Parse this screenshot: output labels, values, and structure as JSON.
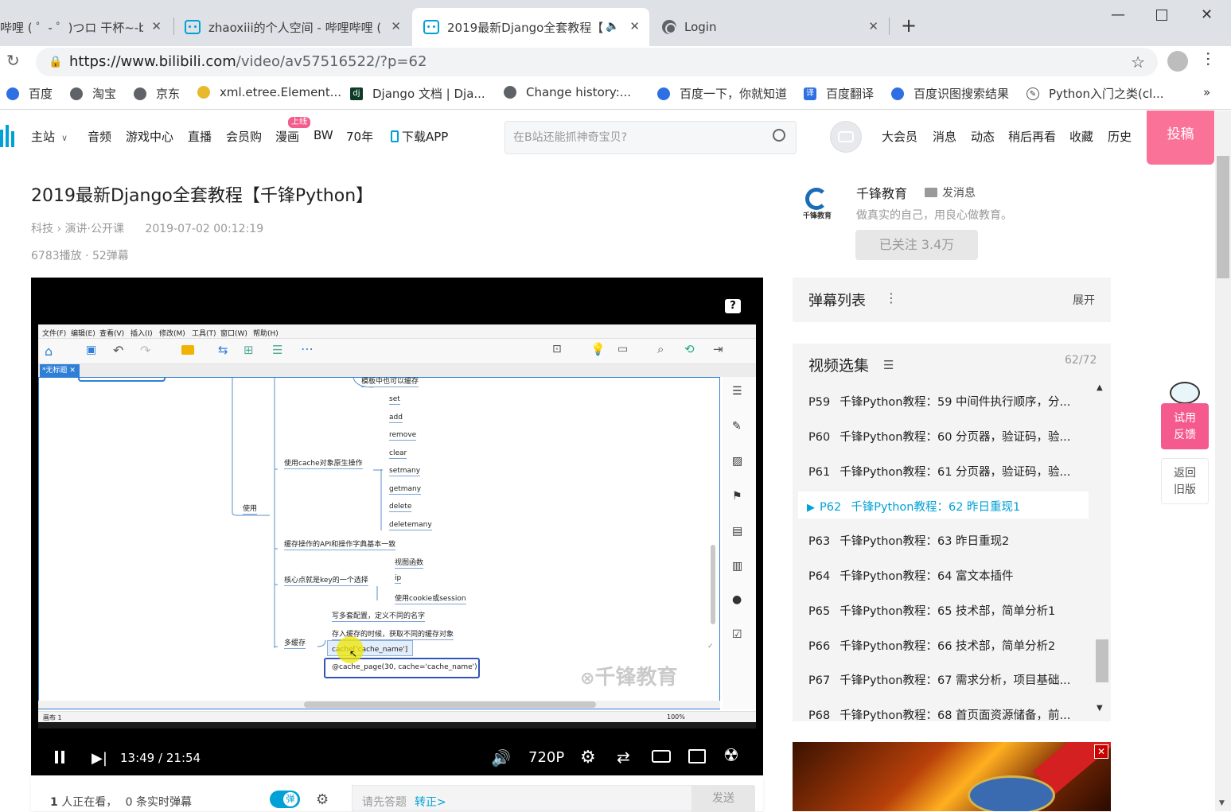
{
  "browser": {
    "tabs": [
      {
        "label": "哔哩 ( ゜- ゜)つロ 干杯~-bili"
      },
      {
        "label": "zhaoxiii的个人空间 - 哔哩哔哩 ("
      },
      {
        "label": "2019最新Django全套教程【"
      },
      {
        "label": "Login"
      }
    ],
    "url_host": "https://www.bilibili.com",
    "url_path": "/video/av57516522/?p=62",
    "bookmarks": [
      "百度",
      "淘宝",
      "京东",
      "xml.etree.Element...",
      "Django 文档 | Dja...",
      "Change history:...",
      "百度一下，你就知道",
      "百度翻译",
      "百度识图搜索结果",
      "Python入门之类(cl..."
    ],
    "bookmarks_more": "»"
  },
  "header": {
    "nav": [
      "主站",
      "音频",
      "游戏中心",
      "直播",
      "会员购",
      "漫画",
      "BW",
      "70年",
      "下载APP"
    ],
    "manga_badge": "上线",
    "search_placeholder": "在B站还能抓神奇宝贝?",
    "right_nav": [
      "大会员",
      "消息",
      "动态",
      "稍后再看",
      "收藏",
      "历史"
    ],
    "upload": "投稿"
  },
  "video": {
    "title": "2019最新Django全套教程【千锋Python】",
    "cat1": "科技",
    "cat2": "演讲·公开课",
    "date": "2019-07-02 00:12:19",
    "stats": "6783播放 · 52弹幕",
    "time_current": "13:49",
    "time_sep": "/",
    "time_total": "21:54",
    "quality": "720P",
    "progress": 0.63
  },
  "uploader": {
    "name": "千锋教育",
    "message": "发消息",
    "desc": "做真实的自己，用良心做教育。",
    "follow": "已关注 3.4万",
    "logo_text": "千锋教育"
  },
  "danmaku": {
    "title": "弹幕列表",
    "expand": "展开"
  },
  "playlist": {
    "title": "视频选集",
    "count": "62/72",
    "items": [
      {
        "p": "P59",
        "title": "千锋Python教程：59 中间件执行顺序，分..."
      },
      {
        "p": "P60",
        "title": "千锋Python教程：60 分页器，验证码，验..."
      },
      {
        "p": "P61",
        "title": "千锋Python教程：61 分页器，验证码，验..."
      },
      {
        "p": "P62",
        "title": "千锋Python教程：62 昨日重现1"
      },
      {
        "p": "P63",
        "title": "千锋Python教程：63 昨日重现2"
      },
      {
        "p": "P64",
        "title": "千锋Python教程：64 富文本插件"
      },
      {
        "p": "P65",
        "title": "千锋Python教程：65 技术部，简单分析1"
      },
      {
        "p": "P66",
        "title": "千锋Python教程：66 技术部，简单分析2"
      },
      {
        "p": "P67",
        "title": "千锋Python教程：67 需求分析，项目基础..."
      },
      {
        "p": "P68",
        "title": "千锋Python教程：68 首页面资源储备，前..."
      }
    ]
  },
  "floating": {
    "feedback": "试用\n反馈",
    "feedback1": "试用",
    "feedback2": "反馈",
    "old1": "返回",
    "old2": "旧版"
  },
  "bottom": {
    "watching_count": "1",
    "watching_text": "人正在看，",
    "live_count": "0",
    "live_text": "条实时弹幕",
    "dm_toggle": "弹",
    "input_placeholder": "请先答题",
    "input_link": "转正>",
    "send": "发送"
  },
  "mindmap": {
    "menu": [
      "文件(F)",
      "编辑(E)",
      "查看(V)",
      "插入(I)",
      "修改(M)",
      "工具(T)",
      "窗口(W)",
      "帮助(H)"
    ],
    "tab": "*无标题",
    "top_node": "模板中也可以缓存",
    "use": "使用",
    "cache_ops": "使用cache对象原生操作",
    "ops": [
      "set",
      "add",
      "remove",
      "clear",
      "setmany",
      "getmany",
      "delete",
      "deletemany"
    ],
    "api_same": "缓存操作的API和操作字典基本一致",
    "key_choice": "核心点就是key的一个选择",
    "key_items": [
      "视图函数",
      "ip",
      "使用cookie或session"
    ],
    "multi": "多缓存",
    "multi_items": [
      "写多套配置，定义不同的名字",
      "存入缓存的时候，获取不同的缓存对象",
      "cache['cache_name']",
      "@cache_page(30, cache='cache_name')"
    ],
    "status": "画布 1",
    "zoom": "100%",
    "watermark": "千锋教育"
  }
}
